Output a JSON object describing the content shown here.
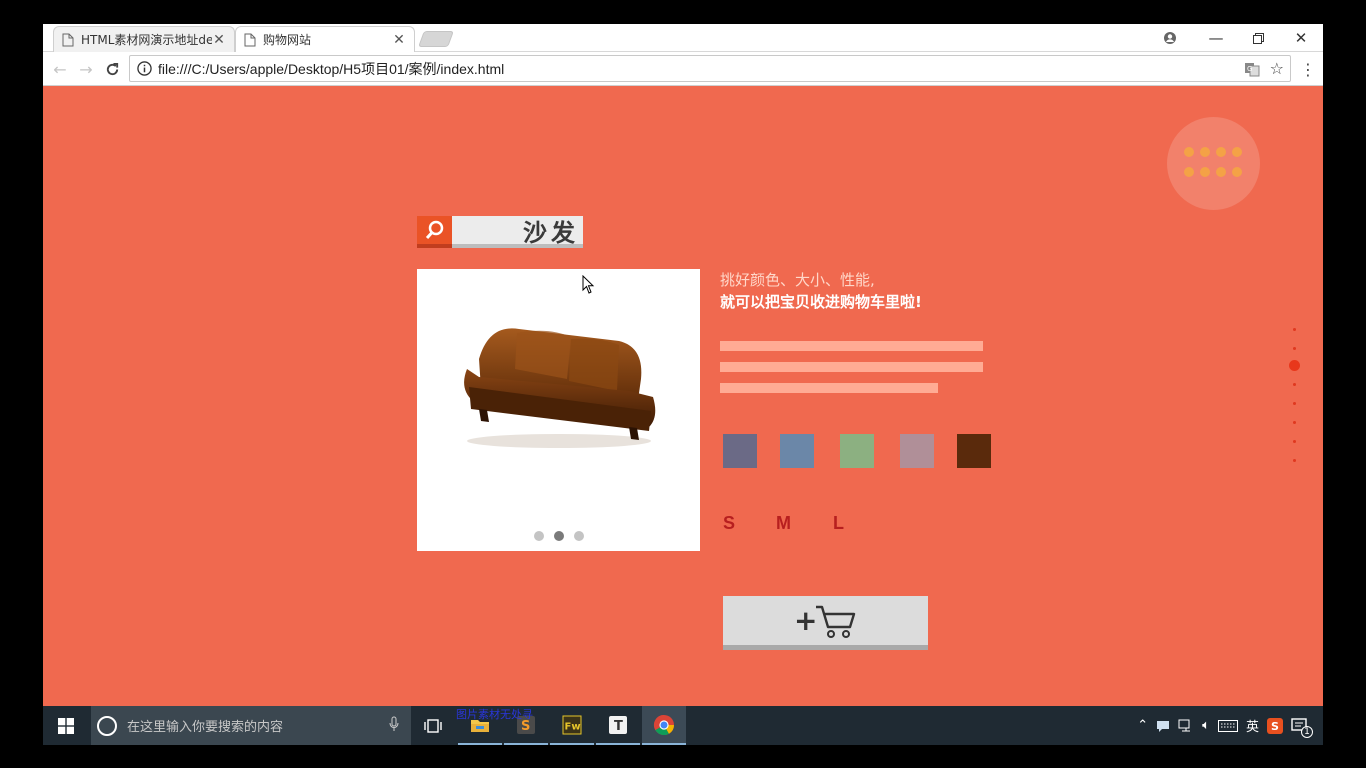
{
  "browser": {
    "tabs": [
      {
        "title": "HTML素材网演示地址de",
        "active": false
      },
      {
        "title": "购物网站",
        "active": true
      }
    ],
    "url": "file:///C:/Users/apple/Desktop/H5项目01/案例/index.html"
  },
  "page": {
    "colors": {
      "background": "#f0694f",
      "accent": "#ea5326",
      "size_text": "#b71f1f"
    },
    "search": {
      "text": "沙发",
      "icon": "search-icon"
    },
    "product": {
      "image": "brown-leather-sofa",
      "slides": 3,
      "current_slide": 2
    },
    "tagline": {
      "line1": "挑好颜色、大小、性能,",
      "line2": "就可以把宝贝收进购物车里啦!"
    },
    "color_swatches": [
      "#6b6a86",
      "#6b87a8",
      "#8cb081",
      "#b08f98",
      "#5a2a0c"
    ],
    "sizes": [
      "S",
      "M",
      "L"
    ],
    "cart_button": {
      "icon": "add-to-cart-icon",
      "label": "+"
    },
    "side_nav": {
      "count": 8,
      "active_index": 2
    }
  },
  "taskbar": {
    "search_placeholder": "在这里输入你要搜索的内容",
    "overlay_text": "图片素材无处寻",
    "apps": [
      "task-view-icon",
      "file-explorer-icon",
      "sublime-text-icon",
      "fireworks-icon",
      "typora-icon",
      "chrome-icon"
    ],
    "tray": {
      "ime": "英",
      "notification_count": "1"
    }
  }
}
